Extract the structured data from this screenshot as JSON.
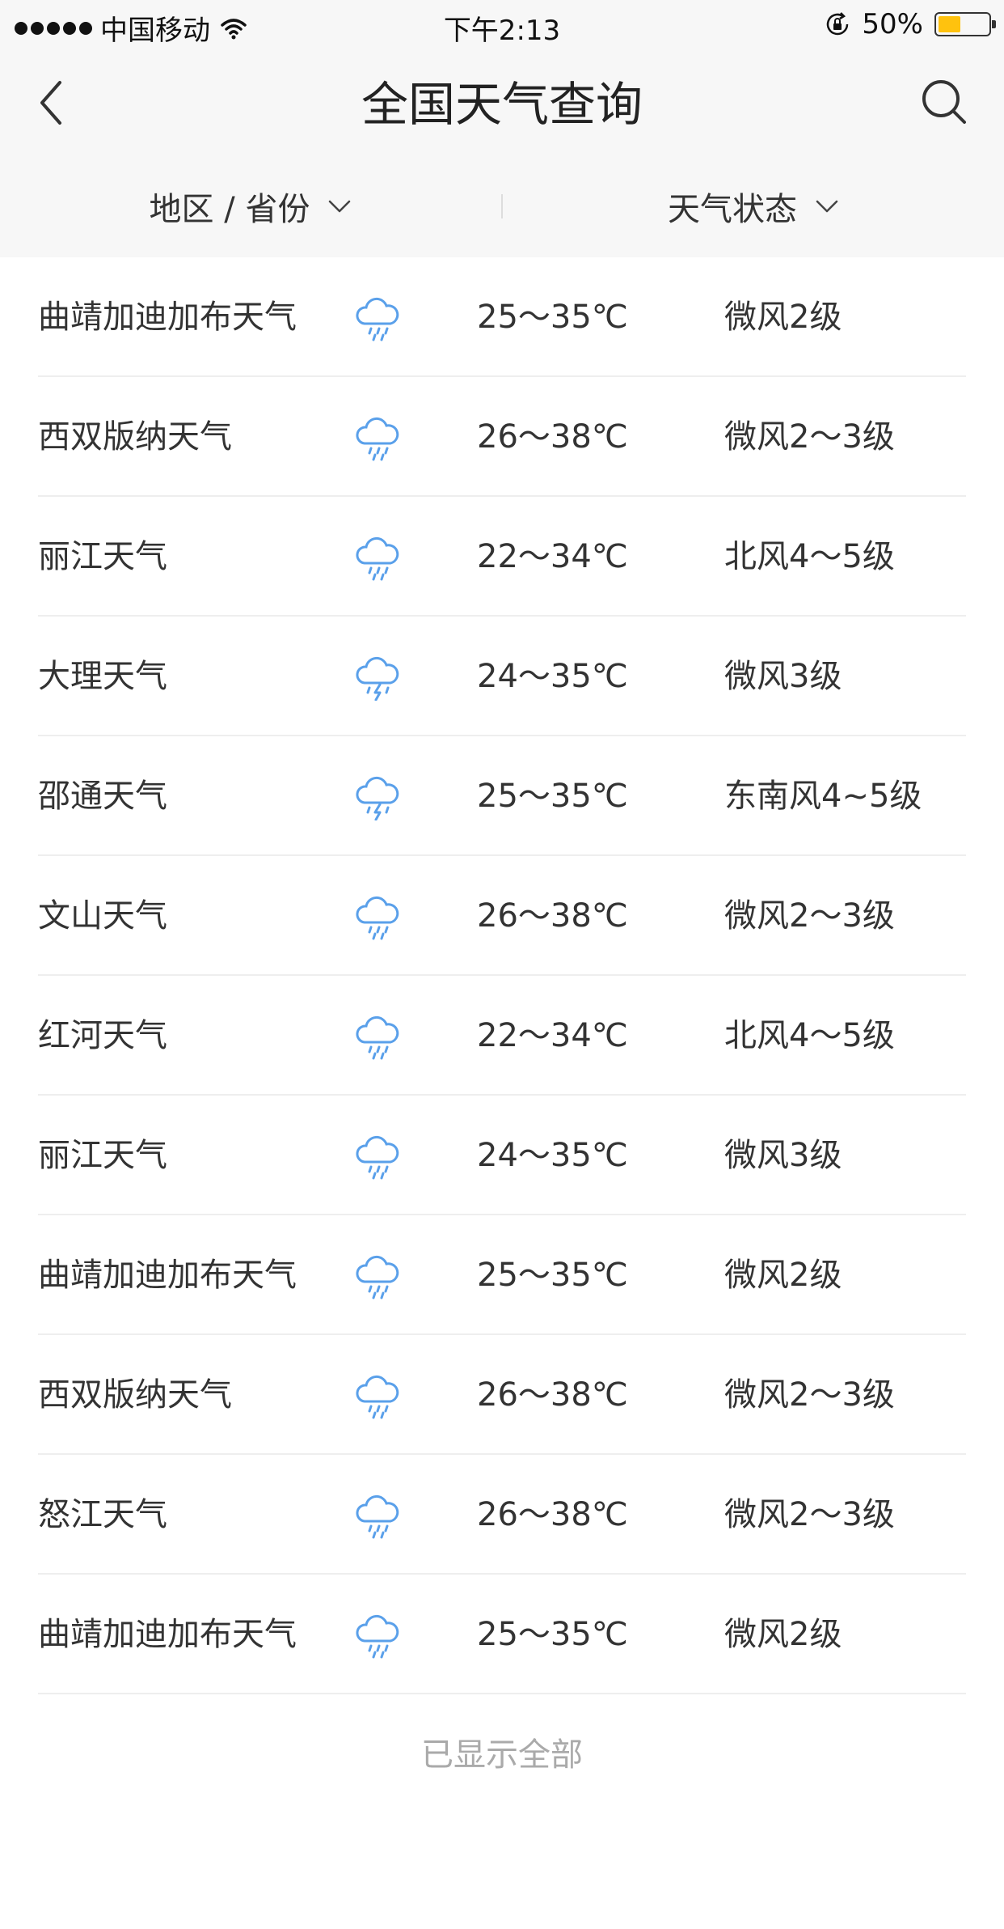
{
  "status": {
    "carrier": "中国移动",
    "time": "下午2:13",
    "battery": "50%",
    "battery_level": 0.5,
    "battery_color": "#ffc20e",
    "icons": [
      "signal-dots-icon",
      "wifi-icon",
      "rotation-lock-icon",
      "battery-icon"
    ]
  },
  "nav": {
    "title": "全国天气查询",
    "back_icon": "back-chevron-icon",
    "search_icon": "search-icon"
  },
  "filters": {
    "region": "地区 / 省份",
    "weather": "天气状态",
    "dropdown_icon": "chevron-down-icon"
  },
  "list": [
    {
      "city": "曲靖加迪加布天气",
      "icon": "rain-cloud-icon",
      "temp": "25～35℃",
      "wind": "微风2级"
    },
    {
      "city": "西双版纳天气",
      "icon": "rain-cloud-icon",
      "temp": "26～38℃",
      "wind": "微风2～3级"
    },
    {
      "city": "丽江天气",
      "icon": "rain-cloud-icon",
      "temp": "22～34℃",
      "wind": "北风4～5级"
    },
    {
      "city": "大理天气",
      "icon": "thunderstorm-cloud-icon",
      "temp": "24～35℃",
      "wind": "微风3级"
    },
    {
      "city": "邵通天气",
      "icon": "thunderstorm-cloud-icon",
      "temp": "25～35℃",
      "wind": "东南风4~5级"
    },
    {
      "city": "文山天气",
      "icon": "rain-cloud-icon",
      "temp": "26～38℃",
      "wind": "微风2～3级"
    },
    {
      "city": "红河天气",
      "icon": "rain-cloud-icon",
      "temp": "22～34℃",
      "wind": "北风4～5级"
    },
    {
      "city": "丽江天气",
      "icon": "rain-cloud-icon",
      "temp": "24～35℃",
      "wind": "微风3级"
    },
    {
      "city": "曲靖加迪加布天气",
      "icon": "rain-cloud-icon",
      "temp": "25～35℃",
      "wind": "微风2级"
    },
    {
      "city": "西双版纳天气",
      "icon": "rain-cloud-icon",
      "temp": "26～38℃",
      "wind": "微风2～3级"
    },
    {
      "city": "怒江天气",
      "icon": "rain-cloud-icon",
      "temp": "26～38℃",
      "wind": "微风2～3级"
    },
    {
      "city": "曲靖加迪加布天气",
      "icon": "rain-cloud-icon",
      "temp": "25～35℃",
      "wind": "微风2级"
    }
  ],
  "footer": "已显示全部",
  "colors": {
    "accent": "#5aa0ea",
    "bar_background": "#f7f7f7",
    "divider": "#eeeeee",
    "footer_text": "#aaaaaa"
  }
}
